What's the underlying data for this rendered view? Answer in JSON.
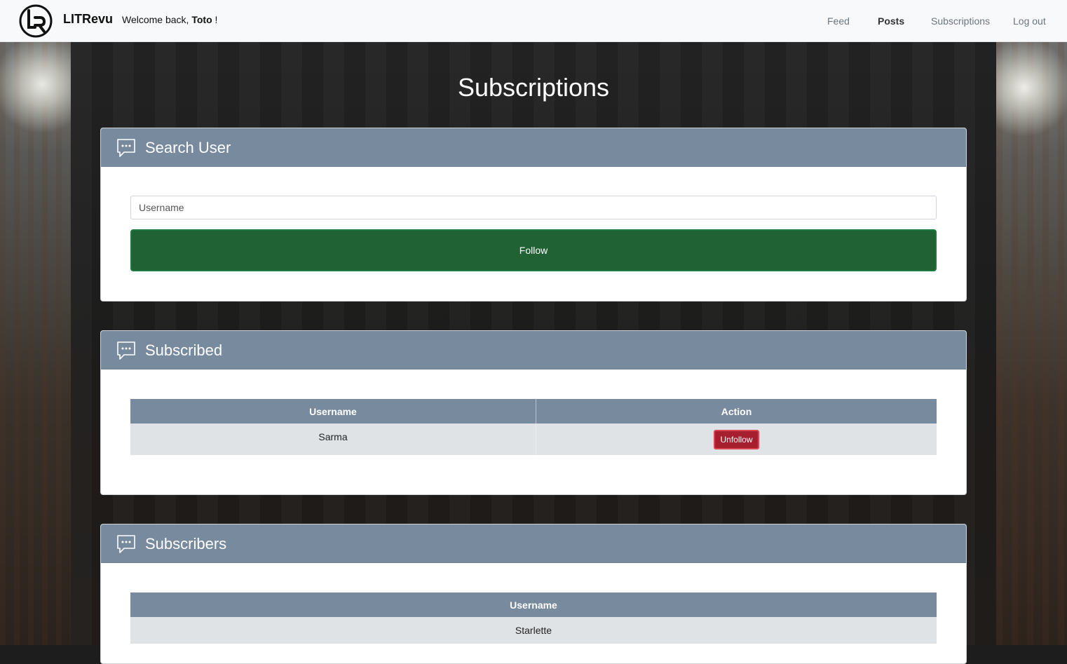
{
  "navbar": {
    "brand": "LITRevu",
    "welcome_prefix": "Welcome back, ",
    "username": "Toto",
    "welcome_suffix": " !",
    "links": [
      {
        "label": "Feed",
        "active": false
      },
      {
        "label": "Posts",
        "active": true
      },
      {
        "label": "Subscriptions",
        "active": false
      },
      {
        "label": "Log out",
        "active": false
      }
    ]
  },
  "page": {
    "title": "Subscriptions"
  },
  "search_card": {
    "title": "Search User",
    "icon": "chat-bubble-icon",
    "input_placeholder": "Username",
    "input_value": "",
    "button_label": "Follow"
  },
  "subscribed_card": {
    "title": "Subscribed",
    "icon": "chat-bubble-icon",
    "columns": [
      "Username",
      "Action"
    ],
    "rows": [
      {
        "username": "Sarma",
        "action_label": "Unfollow"
      }
    ]
  },
  "subscribers_card": {
    "title": "Subscribers",
    "icon": "chat-bubble-icon",
    "columns": [
      "Username"
    ],
    "rows": [
      {
        "username": "Starlette"
      }
    ]
  },
  "colors": {
    "card_header": "#778a9e",
    "follow_button": "#216234",
    "unfollow_button": "#a51f2f",
    "navbar": "#f8f9fa"
  }
}
